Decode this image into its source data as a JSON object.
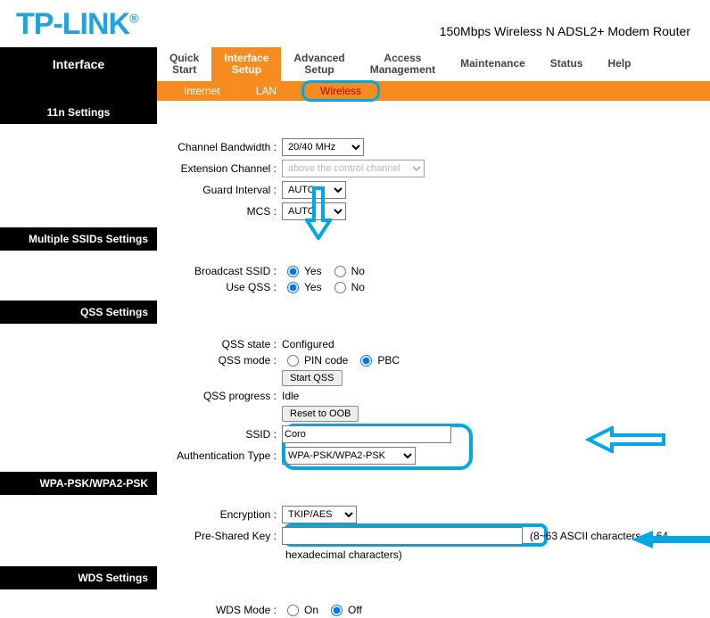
{
  "brand": "TP-LINK",
  "reg": "®",
  "subtitle": "150Mbps Wireless N ADSL2+ Modem Router",
  "page_title": "Interface",
  "tabs": {
    "quick": "Quick\nStart",
    "interface": "Interface\nSetup",
    "advanced": "Advanced\nSetup",
    "access": "Access\nManagement",
    "maint": "Maintenance",
    "status": "Status",
    "help": "Help"
  },
  "subtabs": {
    "internet": "Internet",
    "lan": "LAN",
    "wireless": "Wireless"
  },
  "sections": {
    "s11n": "11n Settings",
    "mssid": "Multiple SSIDs Settings",
    "qss": "QSS Settings",
    "wpa": "WPA-PSK/WPA2-PSK",
    "wds": "WDS Settings"
  },
  "labels": {
    "chanbw": "Channel Bandwidth :",
    "extch": "Extension Channel :",
    "guard": "Guard Interval :",
    "mcs": "MCS :",
    "bssid": "Broadcast SSID :",
    "useqss": "Use QSS :",
    "qssstate": "QSS state :",
    "qssmode": "QSS mode :",
    "qssprog": "QSS progress :",
    "ssid": "SSID :",
    "authtype": "Authentication Type :",
    "enc": "Encryption :",
    "psk": "Pre-Shared Key :",
    "wdsmode": "WDS Mode :"
  },
  "values": {
    "chanbw": "20/40 MHz",
    "extch": "above the control channel",
    "guard": "AUTO",
    "mcs": "AUTO",
    "bssid_yes": "Yes",
    "bssid_no": "No",
    "useqss_yes": "Yes",
    "useqss_no": "No",
    "qssstate": "Configured",
    "qssmode_pin": "PIN code",
    "qssmode_pbc": "PBC",
    "startqss": "Start QSS",
    "qssprog": "Idle",
    "reset_oob": "Reset to OOB",
    "ssid": "Coro",
    "authtype": "WPA-PSK/WPA2-PSK",
    "enc": "TKIP/AES",
    "psk": "",
    "psk_hint1": "(8~63 ASCII characters or 64",
    "psk_hint2": "hexadecimal characters)",
    "wds_on": "On",
    "wds_off": "Off"
  }
}
